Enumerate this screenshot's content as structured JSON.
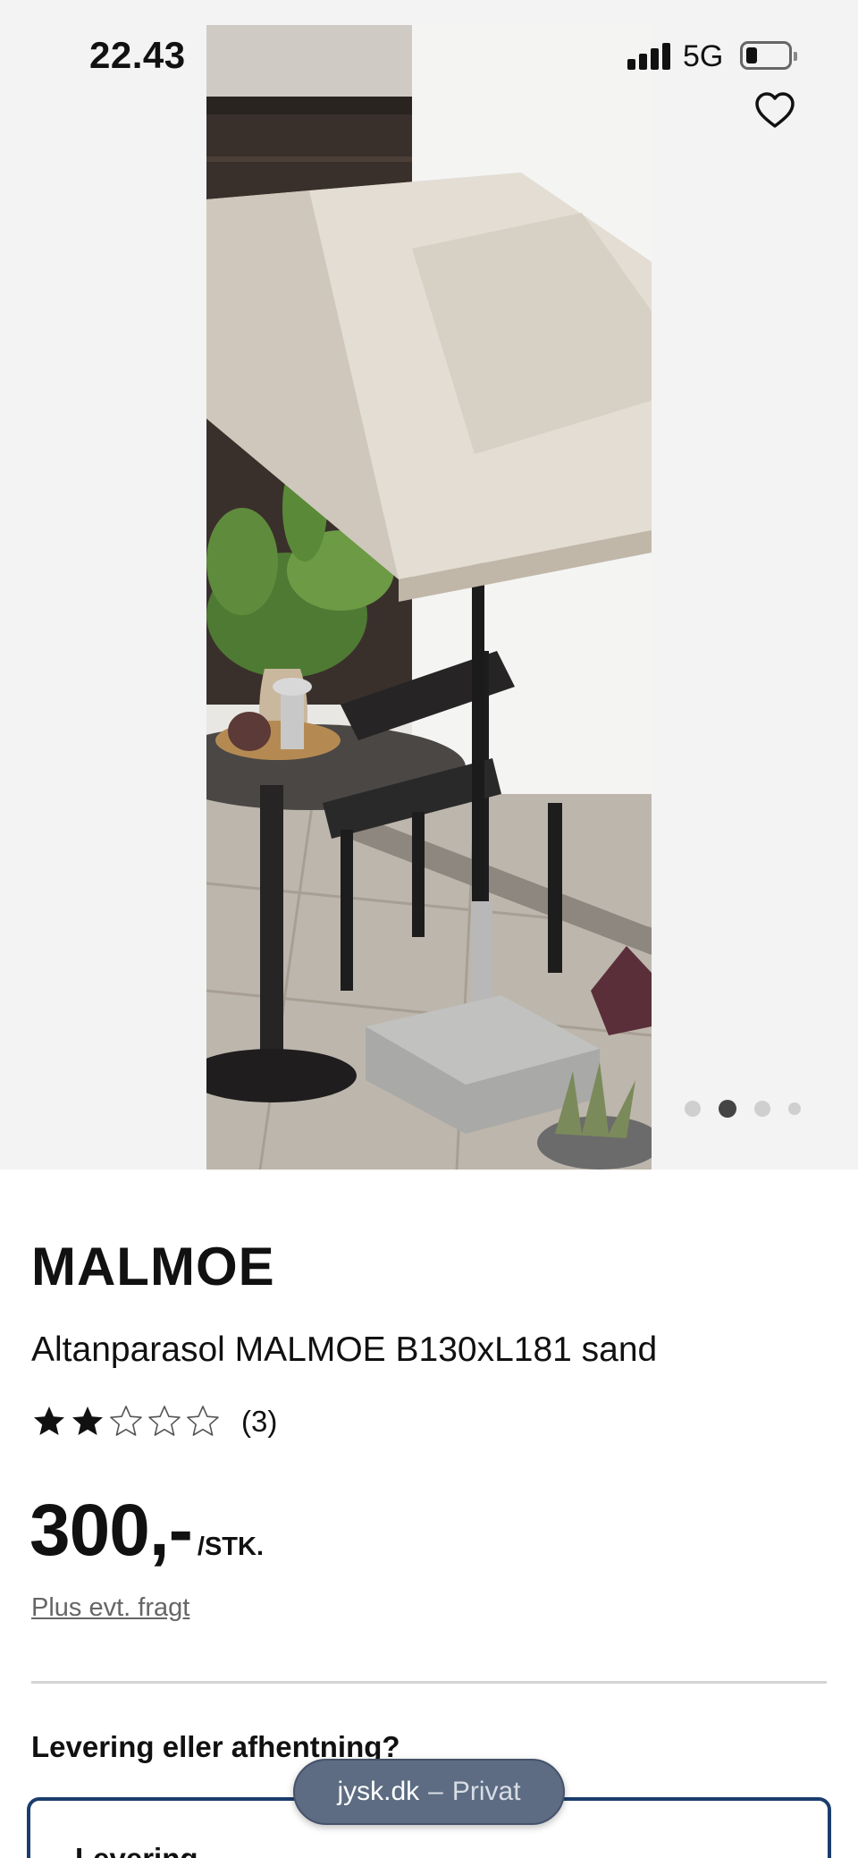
{
  "status_bar": {
    "time": "22.43",
    "network": "5G"
  },
  "gallery": {
    "image_alt": "Altanparasol MALMOE B130xL181 sand",
    "total_images": 4,
    "active_index": 1
  },
  "product": {
    "brand": "MALMOE",
    "name": "Altanparasol MALMOE B130xL181 sand",
    "rating": 2,
    "rating_max": 5,
    "rating_count": "(3)",
    "price": "300,-",
    "price_unit": "/STK.",
    "shipping_note": "Plus evt. fragt"
  },
  "delivery": {
    "heading": "Levering eller afhentning?",
    "option_label": "Levering"
  },
  "browser": {
    "domain": "jysk.dk",
    "separator": "–",
    "mode": "Privat"
  },
  "colors": {
    "accent": "#1b3d6e",
    "hero_background": "#f3f3f3",
    "url_pill": "#5d6c82"
  },
  "icons": {
    "favorite": "heart-outline-icon",
    "rating_full": "star-filled-icon",
    "rating_empty": "star-outline-icon"
  }
}
